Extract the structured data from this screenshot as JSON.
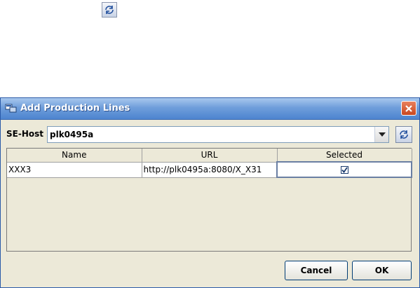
{
  "top_refresh": {
    "icon": "refresh-icon"
  },
  "dialog": {
    "title": "Add Production Lines",
    "app_icon": "production-lines-icon",
    "close_icon": "close-icon"
  },
  "host": {
    "label": "SE-Host",
    "value": "plk0495a",
    "dropdown_icon": "chevron-down-icon",
    "refresh_icon": "refresh-icon"
  },
  "table": {
    "columns": [
      "Name",
      "URL",
      "Selected"
    ],
    "rows": [
      {
        "name": "XXX3",
        "url": "http://plk0495a:8080/X_X31",
        "selected": true
      }
    ]
  },
  "buttons": {
    "cancel": "Cancel",
    "ok": "OK"
  },
  "colors": {
    "title_bar": "#4d84cf",
    "dialog_bg": "#ece9d8",
    "close": "#c9471f"
  }
}
